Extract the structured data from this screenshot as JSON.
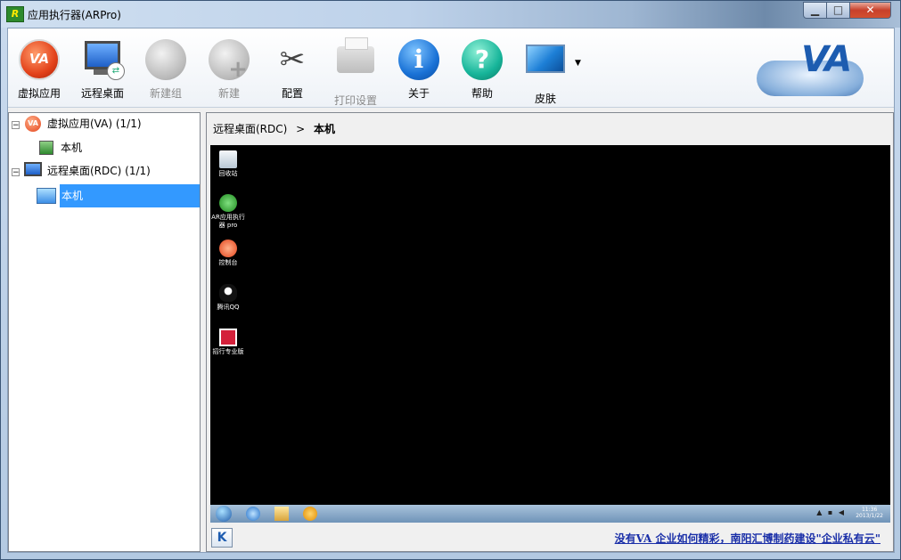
{
  "window": {
    "title": "应用执行器(ARPro)",
    "app_icon_text": "R",
    "controls": {
      "minimize": "▁",
      "maximize": "□",
      "close": "✕"
    }
  },
  "toolbar": {
    "buttons": [
      {
        "label": "虚拟应用",
        "icon": "va-icon",
        "enabled": true
      },
      {
        "label": "远程桌面",
        "icon": "remote-desktop-icon",
        "enabled": true
      },
      {
        "label": "新建组",
        "icon": "new-group-icon",
        "enabled": false
      },
      {
        "label": "新建",
        "icon": "new-icon",
        "enabled": false
      },
      {
        "label": "配置",
        "icon": "config-tools-icon",
        "enabled": true
      },
      {
        "label": "打印设置",
        "icon": "printer-icon",
        "enabled": false
      },
      {
        "label": "关于",
        "icon": "info-icon",
        "enabled": true
      },
      {
        "label": "帮助",
        "icon": "help-icon",
        "enabled": true
      },
      {
        "label": "皮肤",
        "icon": "skin-icon",
        "enabled": true
      }
    ],
    "logo_text": "VA"
  },
  "tree": {
    "nodes": [
      {
        "label": "虚拟应用(VA) (1/1)",
        "children": [
          {
            "label": "本机"
          }
        ]
      },
      {
        "label": "远程桌面(RDC) (1/1)",
        "children": [
          {
            "label": "本机",
            "selected": true
          }
        ]
      }
    ]
  },
  "breadcrumb": {
    "parent": "远程桌面(RDC)",
    "separator": ">",
    "current": "本机"
  },
  "remote_desktop": {
    "icons": [
      {
        "label": "回收站",
        "icon": "recycle-bin-icon"
      },
      {
        "label": "AR应用执行器 pro",
        "icon": "arpro-icon"
      },
      {
        "label": "控制台",
        "icon": "console-icon"
      },
      {
        "label": "腾讯QQ",
        "icon": "qq-icon"
      },
      {
        "label": "招行专业版",
        "icon": "cmb-icon"
      }
    ],
    "clock_time": "11:36",
    "clock_date": "2013/1/22"
  },
  "status": {
    "button_letter": "K",
    "promo_text": "没有VA 企业如何精彩，南阳汇博制药建设\"企业私有云\""
  }
}
